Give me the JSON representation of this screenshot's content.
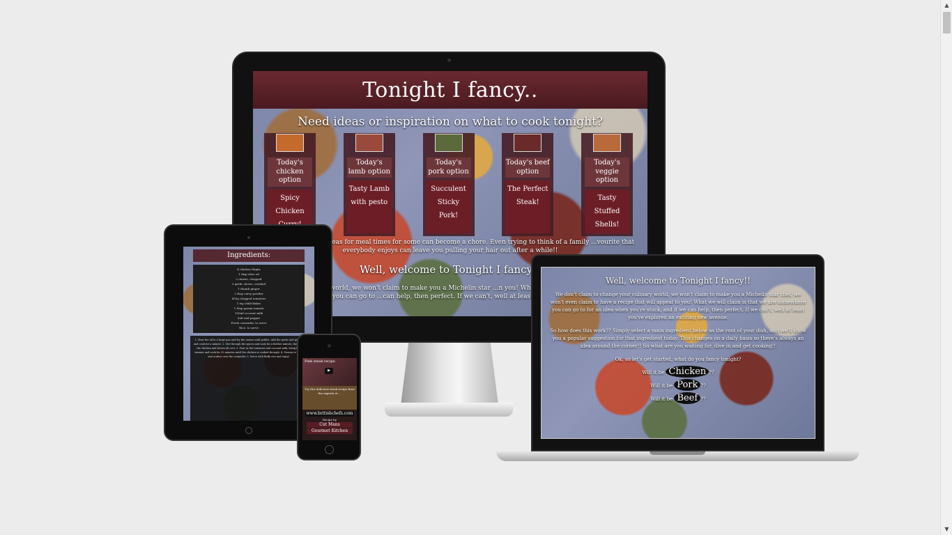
{
  "desktop": {
    "header_title": "Tonight I fancy..",
    "subtitle": "Need ideas or inspiration on what to cook tonight?",
    "cards": [
      {
        "label": "Today's chicken option",
        "dish": "Spicy Chicken Curry!",
        "thumb_color": "#c46a2a"
      },
      {
        "label": "Today's lamb option",
        "dish": "Tasty Lamb with pesto",
        "thumb_color": "#9a4a3a"
      },
      {
        "label": "Today's pork option",
        "dish": "Succulent Sticky Pork!",
        "thumb_color": "#5a6a3a"
      },
      {
        "label": "Today's beef option",
        "dish": "The Perfect Steak!",
        "thumb_color": "#6a2a2a"
      },
      {
        "label": "Today's veggie option",
        "dish": "Tasty Stuffed Shells!",
        "thumb_color": "#b86a3a"
      }
    ],
    "para1": "...original exciting ideas for meal times for some can become a chore. Even trying to think of a family ...vourite that everybody enjoys can leave you pulling your hair out after a while!!",
    "welcome": "Well, welcome to Tonight I fancy!!",
    "para2": "...e your culinary world, we won't claim to make you a Michelin star ...n you! What we will claim is that we are somewhere you can go to ...can help, then perfect. If we can't, well at least you've explored an a..."
  },
  "tablet": {
    "title": "Ingredients:",
    "ingredients": [
      "4 chicken thighs",
      "1 tbsp olive oil",
      "2 onions, chopped",
      "3 garlic cloves, crushed",
      "1 thumb ginger",
      "2 tbsp curry powder",
      "400g chopped tomatoes",
      "1 tsp chilli flakes",
      "1 tbsp garam masala",
      "150ml coconut milk",
      "Salt and pepper",
      "Fresh coriander, to serve",
      "Rice, to serve"
    ],
    "method": "1. Heat the oil in a large pan and fry the onions until golden. Add the garlic and ginger and cook for a minute. 2. Stir through the spices and cook for a further minute, then add the chicken and brown all over. 3. Pour in the tomatoes and coconut milk, bring to a simmer and cook for 25 minutes until the chicken is cooked through. 4. Season to taste and scatter over the coriander. 5. Serve with fluffy rice and enjoy!"
  },
  "phone": {
    "video_title": "Pink steak recipe",
    "play_glyph": "▶",
    "text": "Try this delicious steak recipe from the experts at ...",
    "link": "www.britishchefs.com",
    "sub": "Recipe by",
    "btn1": "Cut Mans",
    "btn2": "Gourmet Kitchen"
  },
  "laptop": {
    "welcome": "Well, welcome to Tonight I fancy!!",
    "para1": "We don't claim to change your culinary world, we won't claim to make you a Michelin star chef, we won't even claim to have a recipe that will appeal to you! What we will claim is that we are somewhere you can go to for an idea when you're stuck, and if we can help, then perfect. If we can't, well at least you've explored an exciting new avenue.",
    "para2": "So how does this work?? Simply select a main ingredient below as the root of your dish, and we'll show you a popular suggestion for that ingredient today. This changes on a daily basis so there's always an idea around the corner!! So what are you waiting for, dive in and get cooking!!",
    "para3": "Ok, so let's get started, what do you fancy tonight?",
    "choices": [
      {
        "prefix": "Will it be",
        "word": "Chicken",
        "suffix": "??"
      },
      {
        "prefix": "Will it be",
        "word": "Pork",
        "suffix": "??"
      },
      {
        "prefix": "Will it be",
        "word": "Beef",
        "suffix": "??"
      }
    ]
  },
  "scrollbar": {
    "up": "▲",
    "down": "▼"
  }
}
